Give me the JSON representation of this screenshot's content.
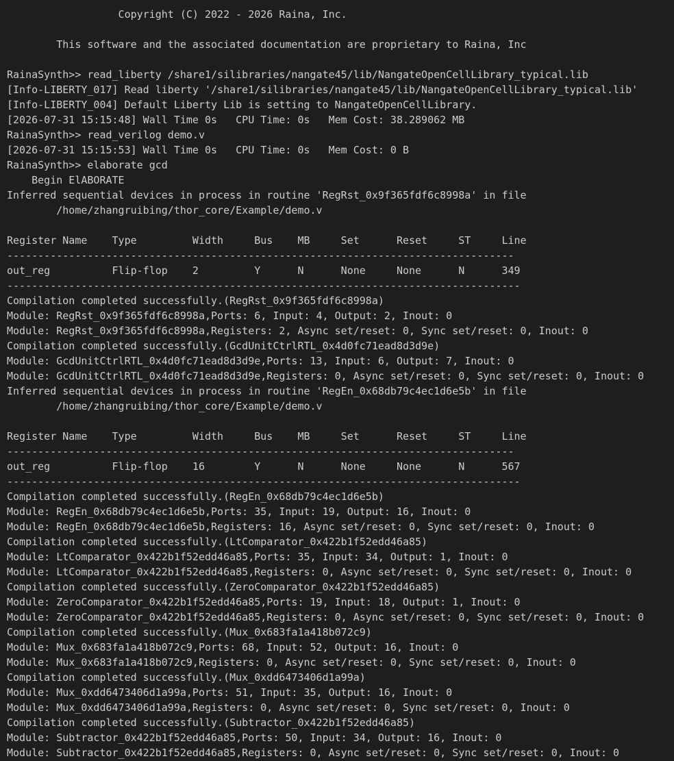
{
  "terminal": {
    "lines": [
      "                  Copyright (C) 2022 - 2026 Raina, Inc.",
      "",
      "        This software and the associated documentation are proprietary to Raina, Inc",
      "",
      "RainaSynth>> read_liberty /share1/silibraries/nangate45/lib/NangateOpenCellLibrary_typical.lib",
      "[Info-LIBERTY_017] Read liberty '/share1/silibraries/nangate45/lib/NangateOpenCellLibrary_typical.lib'",
      "[Info-LIBERTY_004] Default Liberty Lib is setting to NangateOpenCellLibrary.",
      "[2026-07-31 15:15:48] Wall Time 0s   CPU Time: 0s   Mem Cost: 38.289062 MB",
      "RainaSynth>> read_verilog demo.v",
      "[2026-07-31 15:15:53] Wall Time 0s   CPU Time: 0s   Mem Cost: 0 B",
      "RainaSynth>> elaborate gcd",
      "    Begin ElABORATE",
      "Inferred sequential devices in process in routine 'RegRst_0x9f365fdf6c8998a' in file",
      "        /home/zhangruibing/thor_core/Example/demo.v",
      "",
      "Register Name    Type         Width     Bus    MB     Set      Reset     ST     Line",
      "----------------------------------------------------------------------------------",
      "out_reg          Flip-flop    2         Y      N      None     None      N      349",
      "-----------------------------------------------------------------------------------",
      "Compilation completed successfully.(RegRst_0x9f365fdf6c8998a)",
      "Module: RegRst_0x9f365fdf6c8998a,Ports: 6, Input: 4, Output: 2, Inout: 0",
      "Module: RegRst_0x9f365fdf6c8998a,Registers: 2, Async set/reset: 0, Sync set/reset: 0, Inout: 0",
      "Compilation completed successfully.(GcdUnitCtrlRTL_0x4d0fc71ead8d3d9e)",
      "Module: GcdUnitCtrlRTL_0x4d0fc71ead8d3d9e,Ports: 13, Input: 6, Output: 7, Inout: 0",
      "Module: GcdUnitCtrlRTL_0x4d0fc71ead8d3d9e,Registers: 0, Async set/reset: 0, Sync set/reset: 0, Inout: 0",
      "Inferred sequential devices in process in routine 'RegEn_0x68db79c4ec1d6e5b' in file",
      "        /home/zhangruibing/thor_core/Example/demo.v",
      "",
      "Register Name    Type         Width     Bus    MB     Set      Reset     ST     Line",
      "----------------------------------------------------------------------------------",
      "out_reg          Flip-flop    16        Y      N      None     None      N      567",
      "-----------------------------------------------------------------------------------",
      "Compilation completed successfully.(RegEn_0x68db79c4ec1d6e5b)",
      "Module: RegEn_0x68db79c4ec1d6e5b,Ports: 35, Input: 19, Output: 16, Inout: 0",
      "Module: RegEn_0x68db79c4ec1d6e5b,Registers: 16, Async set/reset: 0, Sync set/reset: 0, Inout: 0",
      "Compilation completed successfully.(LtComparator_0x422b1f52edd46a85)",
      "Module: LtComparator_0x422b1f52edd46a85,Ports: 35, Input: 34, Output: 1, Inout: 0",
      "Module: LtComparator_0x422b1f52edd46a85,Registers: 0, Async set/reset: 0, Sync set/reset: 0, Inout: 0",
      "Compilation completed successfully.(ZeroComparator_0x422b1f52edd46a85)",
      "Module: ZeroComparator_0x422b1f52edd46a85,Ports: 19, Input: 18, Output: 1, Inout: 0",
      "Module: ZeroComparator_0x422b1f52edd46a85,Registers: 0, Async set/reset: 0, Sync set/reset: 0, Inout: 0",
      "Compilation completed successfully.(Mux_0x683fa1a418b072c9)",
      "Module: Mux_0x683fa1a418b072c9,Ports: 68, Input: 52, Output: 16, Inout: 0",
      "Module: Mux_0x683fa1a418b072c9,Registers: 0, Async set/reset: 0, Sync set/reset: 0, Inout: 0",
      "Compilation completed successfully.(Mux_0xdd6473406d1a99a)",
      "Module: Mux_0xdd6473406d1a99a,Ports: 51, Input: 35, Output: 16, Inout: 0",
      "Module: Mux_0xdd6473406d1a99a,Registers: 0, Async set/reset: 0, Sync set/reset: 0, Inout: 0",
      "Compilation completed successfully.(Subtractor_0x422b1f52edd46a85)",
      "Module: Subtractor_0x422b1f52edd46a85,Ports: 50, Input: 34, Output: 16, Inout: 0",
      "Module: Subtractor_0x422b1f52edd46a85,Registers: 0, Async set/reset: 0, Sync set/reset: 0, Inout: 0"
    ],
    "colors": {
      "background": "#1e1e1e",
      "text": "#cccccc"
    }
  }
}
